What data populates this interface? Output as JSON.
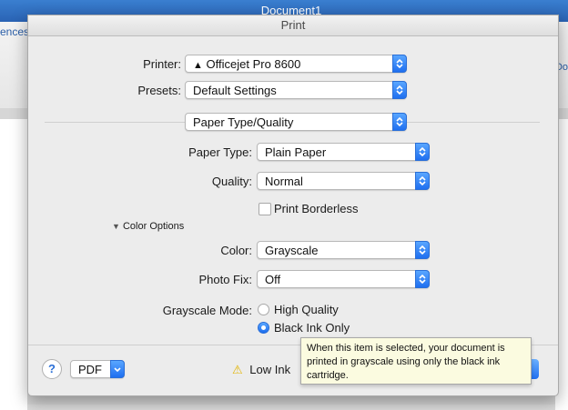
{
  "background_window": {
    "title": "Document1",
    "ribbon_tab_fragment": "ences",
    "ribbon_fragment_right": "Do"
  },
  "dialog": {
    "title": "Print",
    "printer": {
      "label": "Printer:",
      "value": "Officejet Pro 8600"
    },
    "presets": {
      "label": "Presets:",
      "value": "Default Settings"
    },
    "section_popup": {
      "value": "Paper Type/Quality"
    },
    "paper_type": {
      "label": "Paper Type:",
      "value": "Plain Paper"
    },
    "quality": {
      "label": "Quality:",
      "value": "Normal"
    },
    "print_borderless": {
      "label": "Print Borderless",
      "checked": false
    },
    "color_options": {
      "label": "Color Options",
      "expanded": true
    },
    "color": {
      "label": "Color:",
      "value": "Grayscale"
    },
    "photo_fix": {
      "label": "Photo Fix:",
      "value": "Off"
    },
    "grayscale_mode": {
      "label": "Grayscale Mode:",
      "options": [
        {
          "label": "High Quality",
          "selected": false
        },
        {
          "label": "Black Ink Only",
          "selected": true
        }
      ]
    },
    "footer": {
      "help_label": "?",
      "pdf_label": "PDF",
      "low_ink_label": "Low Ink"
    },
    "tooltip": "When this item is selected, your document is printed in grayscale using only the black ink cartridge."
  },
  "colors": {
    "accent": "#1f6ff0",
    "title_bar": "#2a63b4",
    "tooltip_bg": "#fbfbe0",
    "warning": "#f2c200"
  }
}
